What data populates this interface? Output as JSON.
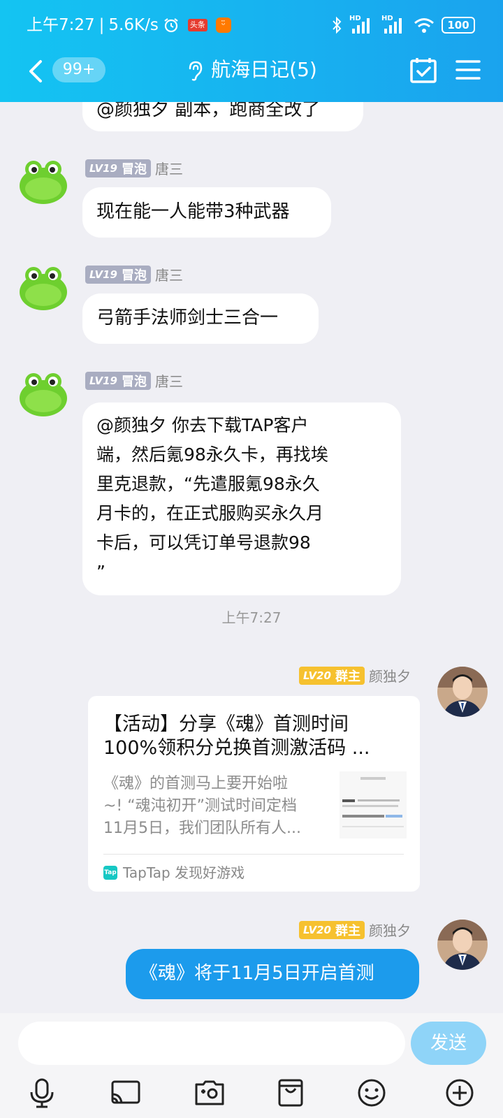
{
  "status_bar": {
    "time": "上午7:27",
    "speed": "5.6K/s",
    "app_badge_1": "头条",
    "battery": "100",
    "hd1": "HD",
    "hd2": "HD"
  },
  "header": {
    "unread_count": "99+",
    "title": "航海日记(5)"
  },
  "messages": [
    {
      "text_partial": "@颜独夕 副本，跑商全改了"
    },
    {
      "level": "LV19",
      "role": "冒泡",
      "sender": "唐三",
      "text": "现在能一人能带3种武器"
    },
    {
      "level": "LV19",
      "role": "冒泡",
      "sender": "唐三",
      "text": "弓箭手法师剑士三合一"
    },
    {
      "level": "LV19",
      "role": "冒泡",
      "sender": "唐三",
      "lines": [
        "@颜独夕 你去下载TAP客户",
        "端，然后氪98永久卡，再找埃",
        "里克退款，“先遣服氪98永久",
        "月卡的，在正式服购买永久月",
        "卡后，可以凭订单号退款98",
        "”"
      ]
    }
  ],
  "timestamp": "上午7:27",
  "card_message": {
    "level": "LV20",
    "role": "群主",
    "sender": "颜独夕",
    "title_line1": "【活动】分享《魂》首测时间",
    "title_line2": "100%领积分兑换首测激活码 ...",
    "desc_line1": "《魂》的首测马上要开始啦",
    "desc_line2": "~! “魂沌初开”测试时间定档",
    "desc_line3": "11月5日，我们团队所有人...",
    "source": "TapTap 发现好游戏",
    "tap_icon_text": "Tap"
  },
  "last_message": {
    "level": "LV20",
    "role": "群主",
    "sender": "颜独夕",
    "text": "《魂》将于11月5日开启首测"
  },
  "input_bar": {
    "placeholder": "",
    "send_label": "发送"
  },
  "colors": {
    "header_start": "#14c4f2",
    "header_end": "#1aa3ee",
    "self_bubble": "#1c9bec",
    "owner_badge": "#f6c12f",
    "member_badge": "#a9adc1"
  },
  "icons": [
    "back-icon",
    "ear-icon",
    "calendar-check-icon",
    "menu-icon",
    "mic-icon",
    "cast-icon",
    "image-icon",
    "gift-icon",
    "emoji-icon",
    "plus-icon"
  ]
}
